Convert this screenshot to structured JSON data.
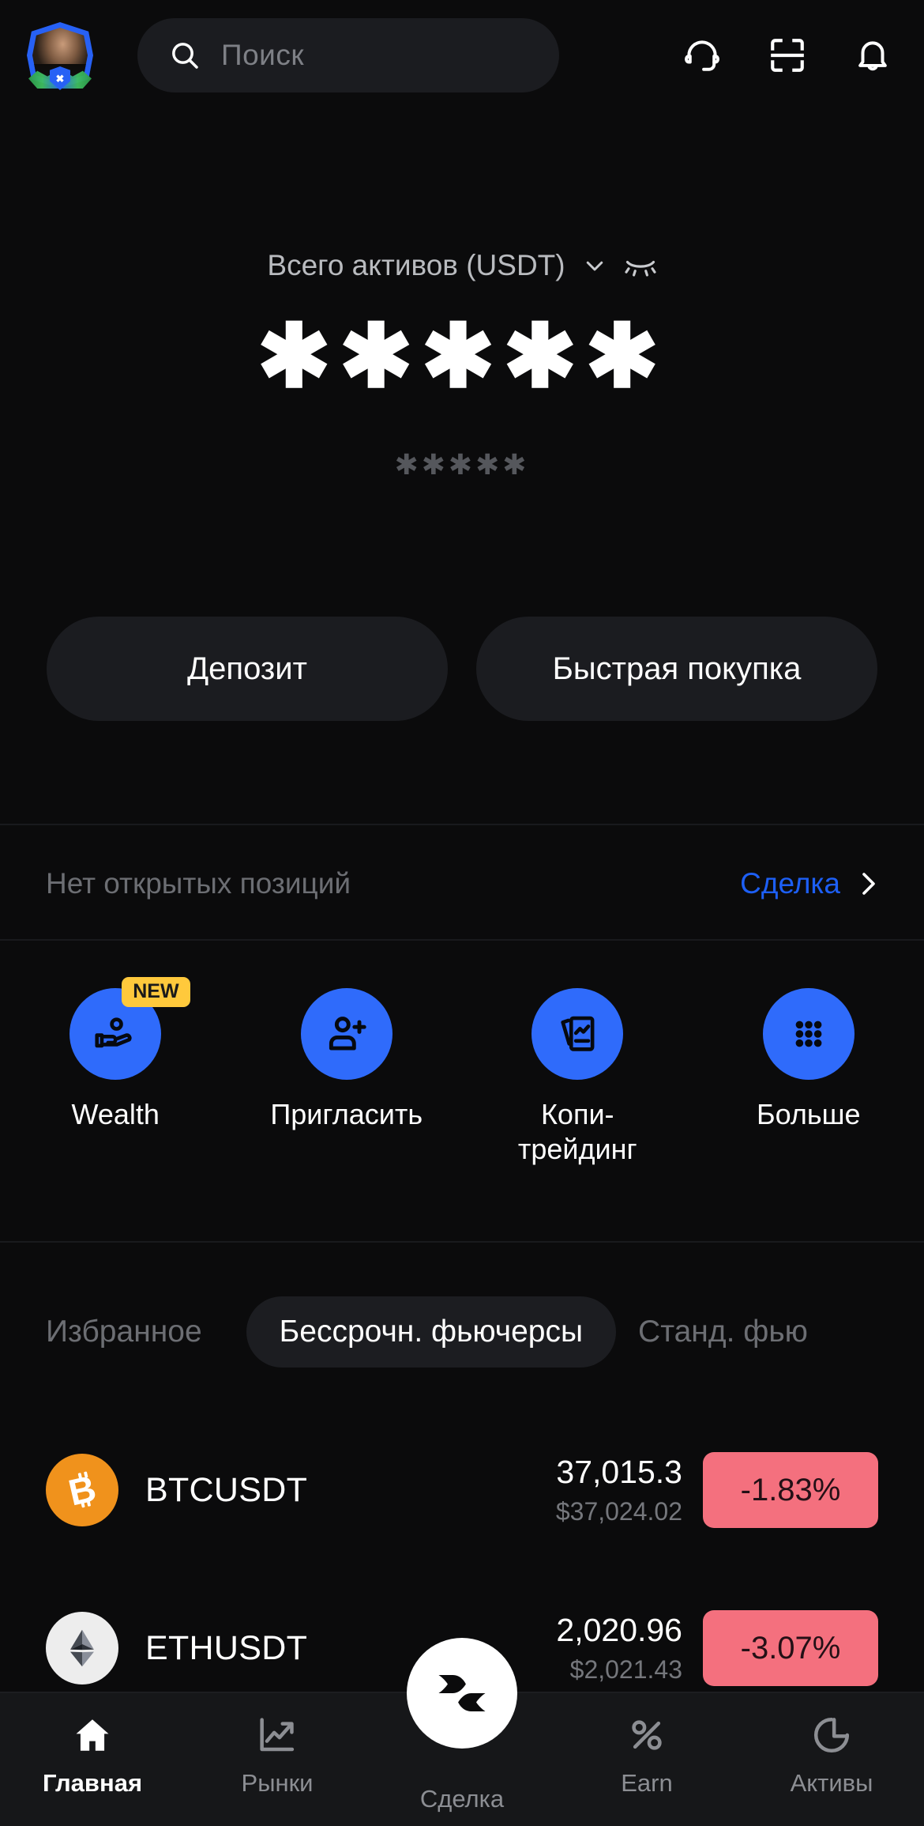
{
  "header": {
    "avatar_name": "user-avatar",
    "avatar_badge_glyph": "✖",
    "search": {
      "placeholder": "Поиск",
      "value": ""
    },
    "icons": [
      {
        "name": "headset-icon",
        "label": "Поддержка"
      },
      {
        "name": "scan-qr-icon",
        "label": "Сканировать"
      },
      {
        "name": "bell-icon",
        "label": "Уведомления"
      }
    ]
  },
  "balance": {
    "label": "Всего активов (USDT)",
    "currency": "USDT",
    "masked_value": "✱✱✱✱✱",
    "masked_sub_value": "✱✱✱✱✱",
    "hidden": true,
    "chevron_icon": "chevron-down-icon",
    "visibility_icon": "eye-hidden-icon"
  },
  "cta": {
    "deposit_label": "Депозит",
    "quick_buy_label": "Быстрая покупка"
  },
  "positions": {
    "empty_text": "Нет открытых позиций",
    "action_label": "Сделка",
    "action_color": "#1d5ff5",
    "chevron_icon": "chevron-right-icon"
  },
  "quick_actions": [
    {
      "label": "Wealth",
      "icon": "hand-coin-icon",
      "badge": "NEW"
    },
    {
      "label": "Пригласить",
      "icon": "person-add-icon",
      "badge": ""
    },
    {
      "label": "Копи-\nтрейдинг",
      "icon": "copy-trading-icon",
      "badge": ""
    },
    {
      "label": "Больше",
      "icon": "grid-dots-icon",
      "badge": ""
    }
  ],
  "market": {
    "tabs": [
      {
        "label": "Избранное",
        "active": false
      },
      {
        "label": "Бессрочн. фьючерсы",
        "active": true
      },
      {
        "label": "Станд. фью",
        "active": false
      }
    ],
    "rows": [
      {
        "symbol": "BTCUSDT",
        "icon": "bitcoin-icon",
        "icon_glyph": "₿",
        "price": "37,015.3",
        "usd_price": "$37,024.02",
        "change": "-1.83%",
        "change_color": "#f4707e"
      },
      {
        "symbol": "ETHUSDT",
        "icon": "ethereum-icon",
        "icon_glyph": "◆",
        "price": "2,020.96",
        "usd_price": "$2,021.43",
        "change": "-3.07%",
        "change_color": "#f4707e"
      }
    ]
  },
  "bottom_nav": {
    "items": [
      {
        "label": "Главная",
        "icon": "home-icon",
        "active": true
      },
      {
        "label": "Рынки",
        "icon": "chart-up-icon",
        "active": false
      },
      {
        "label": "Сделка",
        "icon": "bitget-logo-icon",
        "active": false,
        "fab": true
      },
      {
        "label": "Earn",
        "icon": "percent-icon",
        "active": false
      },
      {
        "label": "Активы",
        "icon": "pie-chart-icon",
        "active": false
      }
    ]
  },
  "colors": {
    "background": "#0b0b0c",
    "surface": "#1b1c20",
    "accent_blue": "#2f6bfb",
    "link_blue": "#1d5ff5",
    "badge_yellow": "#ffc93c",
    "down_red": "#f4707e",
    "btc_orange": "#f0921c"
  }
}
